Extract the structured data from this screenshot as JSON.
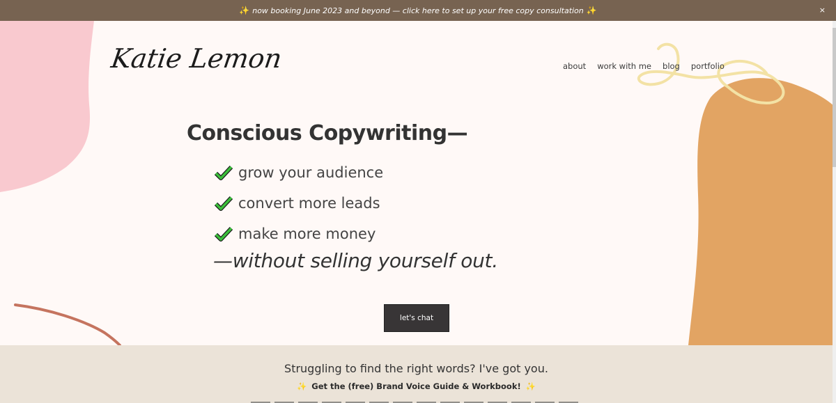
{
  "announcement": {
    "text": "now booking June 2023 and beyond — click here to set up your free copy consultation",
    "spark_left": "✨",
    "spark_right": "✨",
    "close": "×"
  },
  "logo": {
    "text": "Katie Lemon"
  },
  "nav": {
    "items": [
      "about",
      "work with me",
      "blog",
      "portfolio"
    ]
  },
  "hero": {
    "headline": "Conscious Copywriting—",
    "benefits": [
      "grow your audience",
      "convert more leads",
      "make more money"
    ],
    "tagline": "—without selling yourself out.",
    "cta": "let's chat"
  },
  "section2": {
    "title": "Struggling to find the right words? I've got you.",
    "subtitle": "Get the (free) Brand Voice Guide & Workbook!",
    "spark": "✨"
  },
  "colors": {
    "announcement_bg": "#776351",
    "page_bg": "#fff9f7",
    "pink_blob": "#f9c9cf",
    "orange_blob": "#e2a463",
    "yellow_scribble": "#f3e2a5",
    "red_curve": "#c5745f",
    "check_green": "#3bbf3b",
    "cta_bg": "#383536",
    "section2_bg": "#ebe3d8"
  }
}
